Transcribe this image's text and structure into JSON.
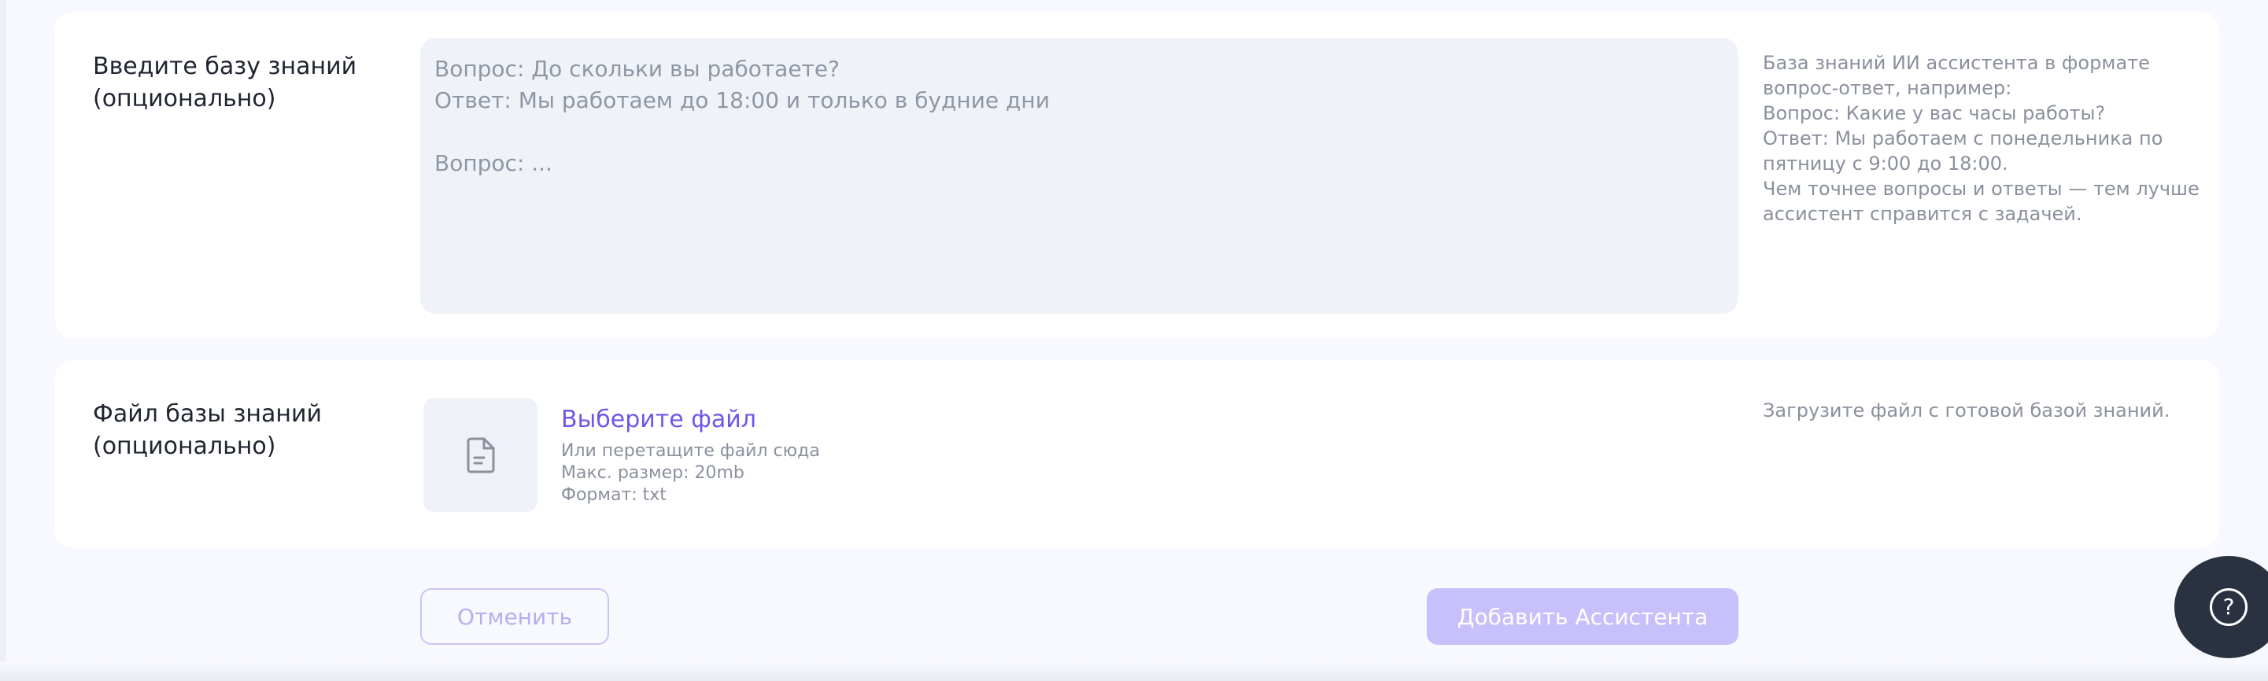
{
  "knowledge_base": {
    "label": "Введите базу знаний\n(опционально)",
    "placeholder": "Вопрос: До скольки вы работаете?\nОтвет: Мы работаем до 18:00 и только в будние дни\n\nВопрос: ...",
    "help": "База знаний ИИ ассистента в формате\nвопрос-ответ, например:\nВопрос: Какие у вас часы работы?\nОтвет: Мы работаем с понедельника по\nпятницу с 9:00 до 18:00.\nЧем точнее вопросы и ответы — тем лучше\nассистент справится с задачей."
  },
  "file_upload": {
    "label": "Файл базы знаний\n(опционально)",
    "choose_link": "Выберите файл",
    "drag_hint": "Или перетащите файл сюда",
    "max_size": "Макс. размер: 20mb",
    "format": "Формат: txt",
    "help": "Загрузите файл с готовой базой знаний.",
    "icon": "document-icon"
  },
  "actions": {
    "cancel_label": "Отменить",
    "submit_label": "Добавить Ассистента"
  },
  "help_button": {
    "icon": "question-circle-icon",
    "glyph": "?"
  },
  "colors": {
    "accent": "#6b58e6",
    "submit_disabled_bg": "#c7c0fb",
    "page_bg": "#f8f9fe",
    "fab_bg": "#2a3140"
  }
}
